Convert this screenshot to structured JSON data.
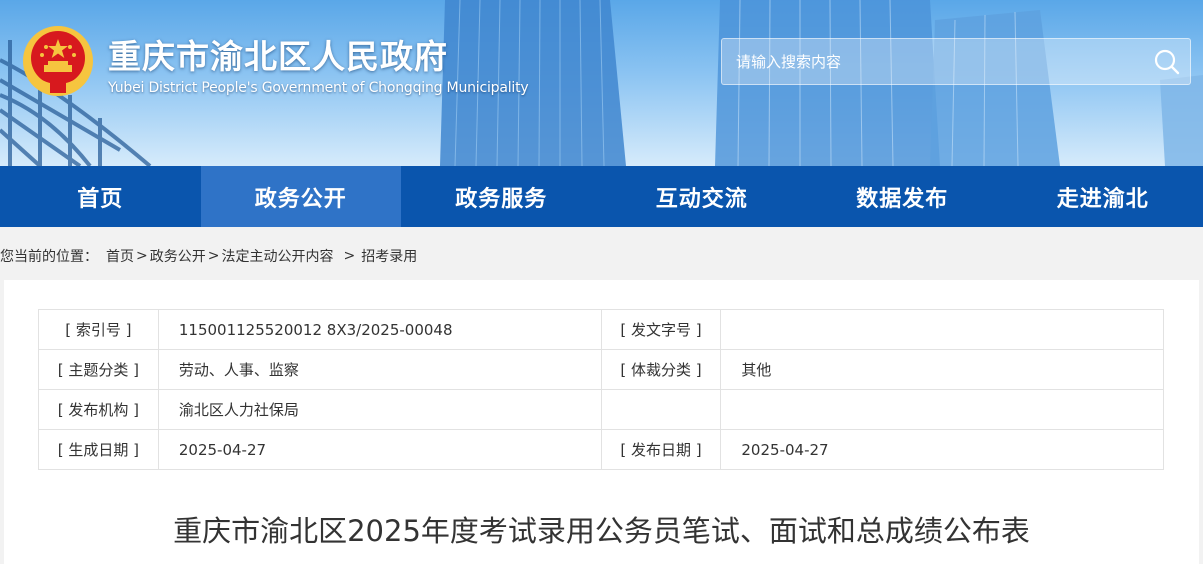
{
  "header": {
    "title": "重庆市渝北区人民政府",
    "subtitle": "Yubei District People's Government of Chongqing Municipality",
    "search_placeholder": "请输入搜索内容"
  },
  "nav": {
    "items": [
      {
        "label": "首页"
      },
      {
        "label": "政务公开"
      },
      {
        "label": "政务服务"
      },
      {
        "label": "互动交流"
      },
      {
        "label": "数据发布"
      },
      {
        "label": "走进渝北"
      }
    ],
    "active_index": 1
  },
  "breadcrumb": {
    "prefix": "您当前的位置：",
    "items": [
      "首页",
      "政务公开",
      "法定主动公开内容",
      "招考录用"
    ],
    "separator": ">"
  },
  "meta": {
    "rows": [
      {
        "label1": "[ 索引号 ]",
        "value1": "115001125520012 8X3/2025-00048",
        "label2": "[ 发文字号 ]",
        "value2": ""
      },
      {
        "label1": "[ 主题分类 ]",
        "value1": "劳动、人事、监察",
        "label2": "[ 体裁分类 ]",
        "value2": "其他"
      },
      {
        "label1": "[ 发布机构 ]",
        "value1": "渝北区人力社保局",
        "label2": "",
        "value2": ""
      },
      {
        "label1": "[ 生成日期 ]",
        "value1": "2025-04-27",
        "label2": "[ 发布日期 ]",
        "value2": "2025-04-27"
      }
    ]
  },
  "article": {
    "title": "重庆市渝北区2025年度考试录用公务员笔试、面试和总成绩公布表"
  },
  "colors": {
    "nav_bg": "#0a55ad",
    "nav_active": "#2f73c7",
    "emblem_red": "#d7191e",
    "emblem_gold": "#f6c53f"
  },
  "icons": {
    "emblem": "national-emblem-icon",
    "search": "search-icon"
  }
}
